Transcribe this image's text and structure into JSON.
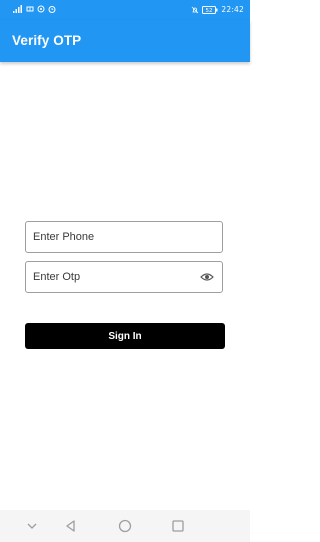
{
  "status_bar": {
    "time": "22:42",
    "battery": "52"
  },
  "app_bar": {
    "title": "Verify OTP",
    "color": "#2196f3"
  },
  "form": {
    "phone_placeholder": "Enter Phone",
    "otp_placeholder": "Enter Otp",
    "otp_toggle_icon": "eye-icon",
    "signin_label": "Sign In"
  },
  "nav_bar": {
    "icons": [
      "chevron-down-icon",
      "back-triangle-icon",
      "home-circle-icon",
      "recents-square-icon"
    ]
  }
}
